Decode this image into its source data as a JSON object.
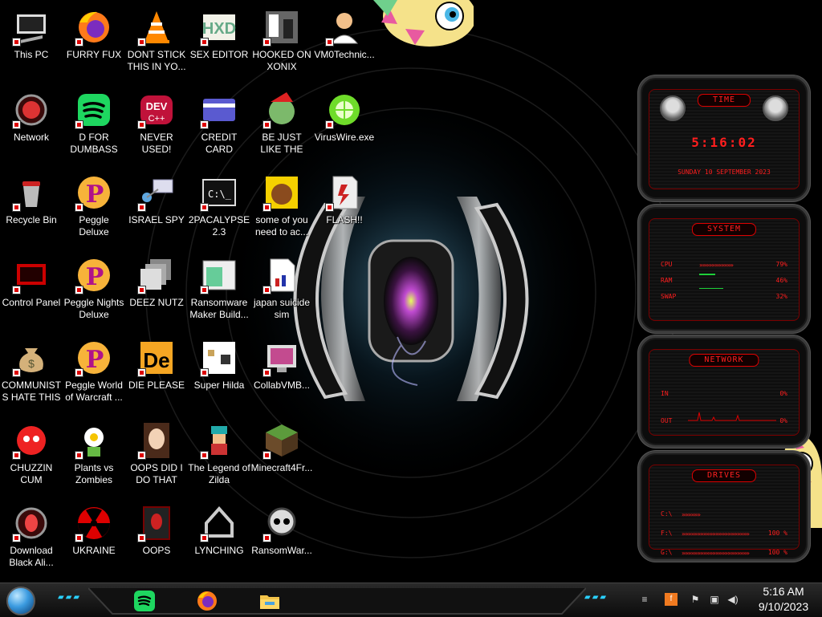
{
  "desktop": {
    "icons": [
      {
        "label": "This PC",
        "icon": "computer-icon"
      },
      {
        "label": "Network",
        "icon": "network-icon"
      },
      {
        "label": "Recycle Bin",
        "icon": "recycle-bin-icon"
      },
      {
        "label": "Control Panel",
        "icon": "control-panel-icon"
      },
      {
        "label": "COMMUNISTS HATE THIS G...",
        "icon": "money-bag-icon"
      },
      {
        "label": "CHUZZIN CUM",
        "icon": "chuzzle-icon"
      },
      {
        "label": "Download Black Ali...",
        "icon": "alien-icon"
      },
      {
        "label": "FURRY FUX",
        "icon": "firefox-icon"
      },
      {
        "label": "D FOR DUMBASS",
        "icon": "spotify-icon"
      },
      {
        "label": "Peggle Deluxe",
        "icon": "peggle-icon"
      },
      {
        "label": "Peggle Nights Deluxe",
        "icon": "peggle-icon"
      },
      {
        "label": "Peggle World of Warcraft ...",
        "icon": "peggle-icon"
      },
      {
        "label": "Plants vs Zombies",
        "icon": "plant-icon"
      },
      {
        "label": "UKRAINE",
        "icon": "radiation-icon"
      },
      {
        "label": "DONT STICK THIS IN YO...",
        "icon": "vlc-icon"
      },
      {
        "label": "NEVER USED!",
        "icon": "devcpp-icon"
      },
      {
        "label": "ISRAEL SPY",
        "icon": "spy-icon"
      },
      {
        "label": "DEEZ NUTZ",
        "icon": "windows-stack-icon"
      },
      {
        "label": "DIE PLEASE",
        "icon": "de-icon"
      },
      {
        "label": "OOPS DID I DO THAT",
        "icon": "portrait-icon"
      },
      {
        "label": "OOPS",
        "icon": "alien-monitor-icon"
      },
      {
        "label": "SEX EDITOR",
        "icon": "hxd-icon"
      },
      {
        "label": "CREDIT CARD CHECKER",
        "icon": "credit-card-icon"
      },
      {
        "label": "2PACALYPSE 2.3",
        "icon": "console-icon"
      },
      {
        "label": "Ransomware Maker Build...",
        "icon": "window-icon"
      },
      {
        "label": "Super Hilda",
        "icon": "pixel-dog-icon"
      },
      {
        "label": "The Legend of Zilda",
        "icon": "pixel-hero-icon"
      },
      {
        "label": "LYNCHING",
        "icon": "hanger-icon"
      },
      {
        "label": "HOOKED ON XONIX",
        "icon": "xonix-icon"
      },
      {
        "label": "BE JUST LIKE THE DUDE!",
        "icon": "elf-icon"
      },
      {
        "label": "some of you need to ac...",
        "icon": "beaver-icon"
      },
      {
        "label": "japan suicide sim",
        "icon": "document-icon"
      },
      {
        "label": "CollabVMB...",
        "icon": "collabvm-icon"
      },
      {
        "label": "Minecraft4Fr...",
        "icon": "minecraft-icon"
      },
      {
        "label": "RansomWar...",
        "icon": "skull-icon"
      },
      {
        "label": "VM0Technic...",
        "icon": "doctor-icon"
      },
      {
        "label": "VirusWire.exe",
        "icon": "limewire-icon"
      },
      {
        "label": "FLASH!!",
        "icon": "flash-icon"
      }
    ]
  },
  "gadgets": {
    "time": {
      "title": "TIME",
      "clock": "5:16:02",
      "date": "SUNDAY 10 SEPTEMBER 2023"
    },
    "system": {
      "title": "SYSTEM",
      "rows": [
        {
          "key": "CPU",
          "value": "79%",
          "level": 0.79
        },
        {
          "key": "RAM",
          "value": "46%",
          "level": 0.46
        },
        {
          "key": "SWAP",
          "value": "32%",
          "level": 0.32
        }
      ]
    },
    "network": {
      "title": "NETWORK",
      "rows": [
        {
          "key": "IN",
          "value": "0%"
        },
        {
          "key": "OUT",
          "value": "0%"
        }
      ]
    },
    "drives": {
      "title": "DRIVES",
      "rows": [
        {
          "key": "C:\\",
          "value": ""
        },
        {
          "key": "F:\\",
          "value": "100 %"
        },
        {
          "key": "G:\\",
          "value": "100 %"
        }
      ]
    }
  },
  "taskbar": {
    "start": "start-orb-icon",
    "apps": [
      {
        "name": "spotify-icon"
      },
      {
        "name": "firefox-icon"
      },
      {
        "name": "file-explorer-icon"
      }
    ],
    "tray": [
      "flash-tray-icon",
      "action-flag-icon",
      "network-tray-icon",
      "volume-icon"
    ],
    "time": "5:16 AM",
    "date": "9/10/2023"
  },
  "colors": {
    "accent": "#ff1e1e",
    "taskbar_accent": "#2ad0ff"
  }
}
